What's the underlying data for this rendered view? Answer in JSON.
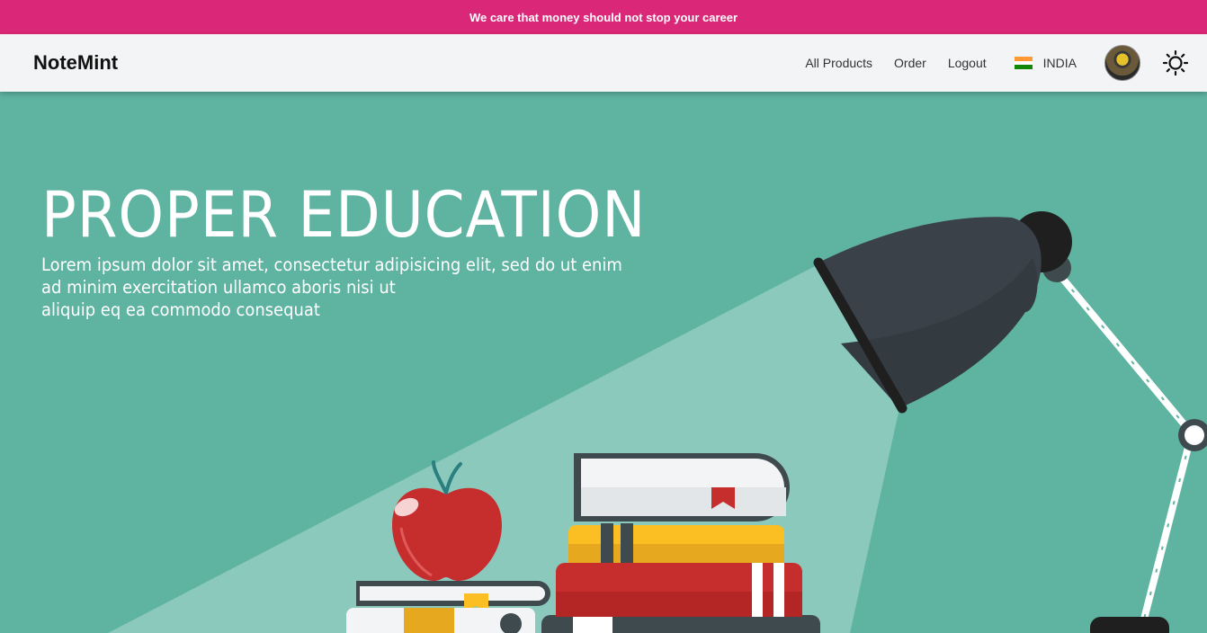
{
  "announcement": "We care that money should not stop your career",
  "brand": "NoteMint",
  "nav": {
    "all_products": "All Products",
    "order": "Order",
    "logout": "Logout",
    "country": "INDIA"
  },
  "hero": {
    "title": "PROPER EDUCATION",
    "lines": [
      "Lorem ipsum dolor sit amet, consectetur adipisicing elit, sed do ut enim",
      "ad minim exercitation ullamco aboris nisi ut",
      "aliquip eq ea commodo consequat"
    ]
  },
  "colors": {
    "announcement_bg": "#db2777",
    "navbar_bg": "#f3f4f6",
    "hero_bg": "#5fb3a1",
    "light_beam": "#8bc9bc"
  },
  "icons": {
    "flag": "india-flag-icon",
    "avatar": "user-avatar",
    "theme": "sun-icon"
  }
}
